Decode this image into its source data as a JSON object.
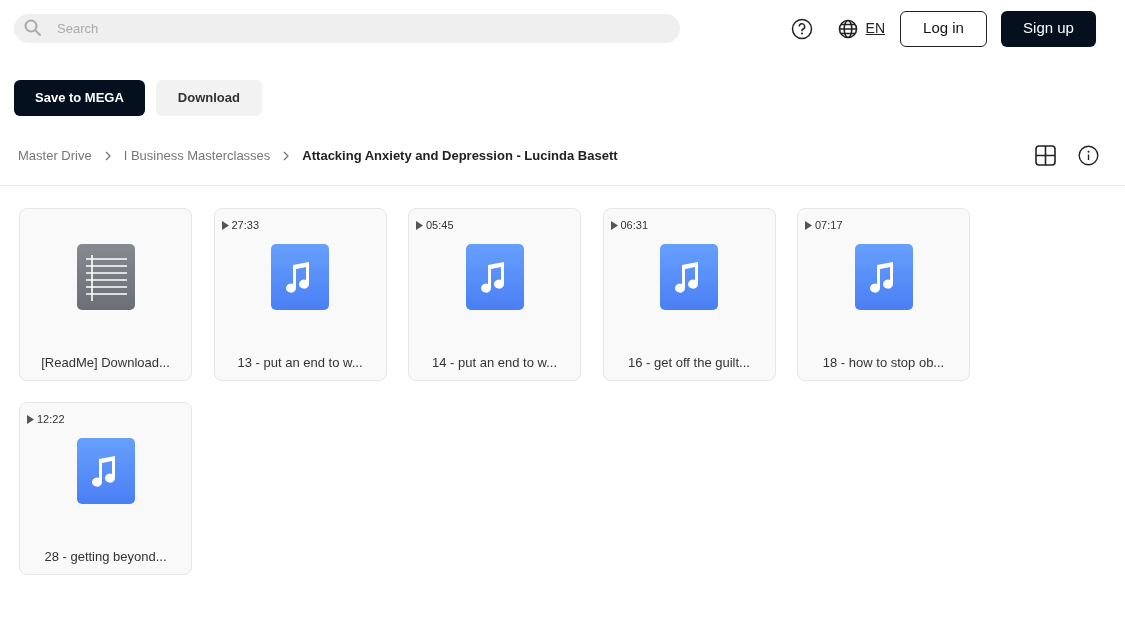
{
  "header": {
    "search": {
      "placeholder": "Search"
    },
    "language": "EN",
    "buttons": [
      "Log in",
      "Sign up"
    ]
  },
  "actions": [
    "Save to MEGA",
    "Download"
  ],
  "breadcrumb": [
    {
      "label": "Master Drive",
      "current": false
    },
    {
      "label": "I Business Masterclasses",
      "current": false
    },
    {
      "label": "Attacking Anxiety and Depression - Lucinda Basett",
      "current": true
    }
  ],
  "files": [
    {
      "kind": "document",
      "name": "[ReadMe] Download..."
    },
    {
      "kind": "audio",
      "duration": "27:33",
      "name": "13 - put an end to w..."
    },
    {
      "kind": "audio",
      "duration": "05:45",
      "name": "14 - put an end to w..."
    },
    {
      "kind": "audio",
      "duration": "06:31",
      "name": "16 - get off the guilt..."
    },
    {
      "kind": "audio",
      "duration": "07:17",
      "name": "18 - how to stop ob..."
    },
    {
      "kind": "audio",
      "duration": "12:22",
      "name": "28 - getting beyond..."
    }
  ]
}
